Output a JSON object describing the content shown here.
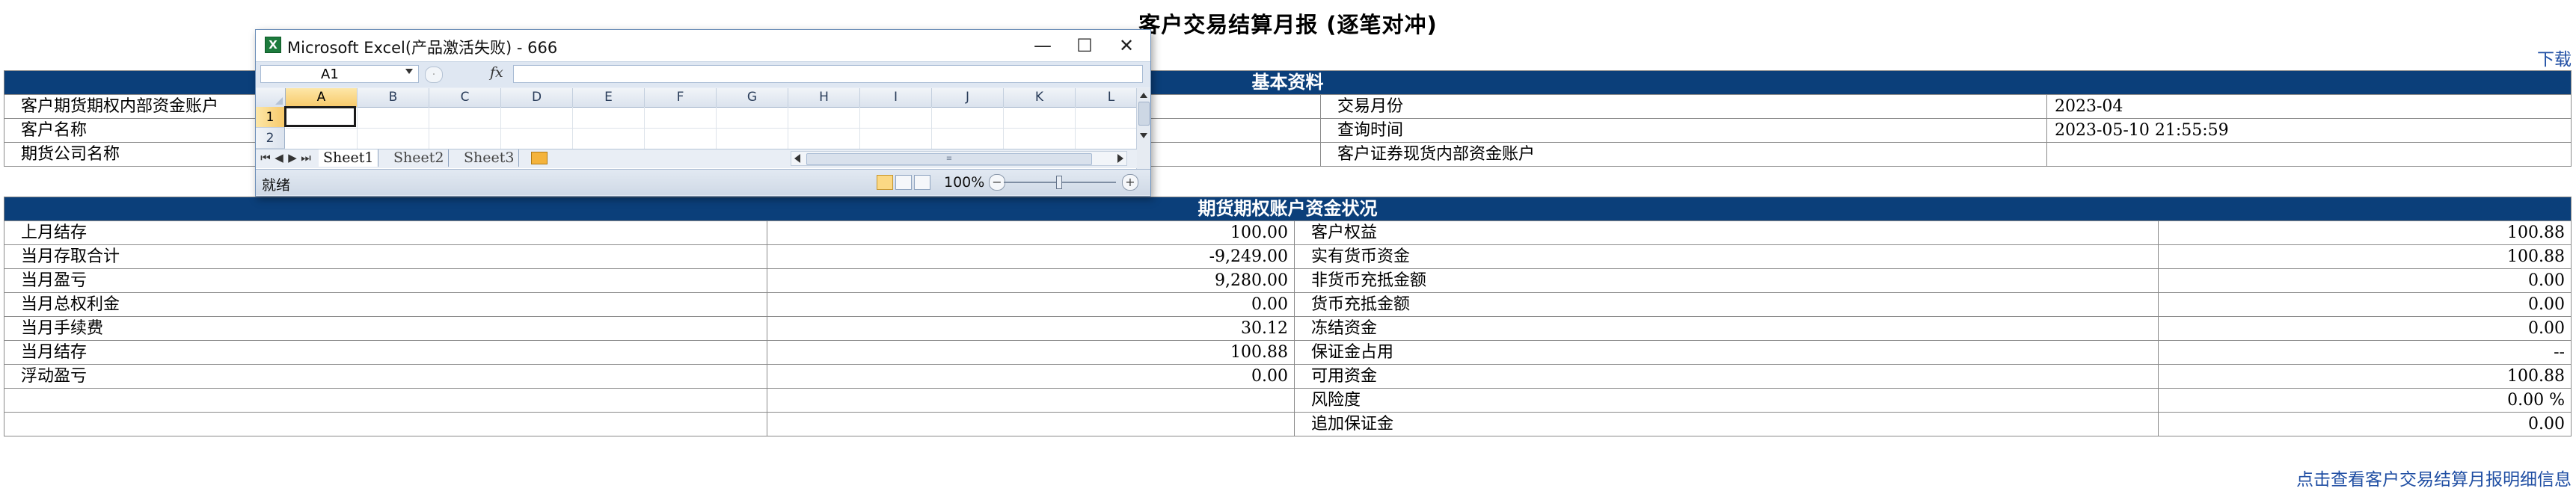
{
  "page": {
    "title": "客户交易结算月报 (逐笔对冲)",
    "download_label": "下载",
    "detail_link": "点击查看客户交易结算月报明细信息"
  },
  "basic_info": {
    "header": "基本资料",
    "rows": [
      {
        "label1": "客户期货期权内部资金账户",
        "value1": "",
        "label2": "交易月份",
        "value2": "2023-04"
      },
      {
        "label1": "客户名称",
        "value1": "",
        "label2": "查询时间",
        "value2": "2023-05-10 21:55:59"
      },
      {
        "label1": "期货公司名称",
        "value1": "",
        "label2": "客户证券现货内部资金账户",
        "value2": ""
      }
    ]
  },
  "funds": {
    "header": "期货期权账户资金状况",
    "rows": [
      {
        "label1": "上月结存",
        "value1": "100.00",
        "label2": "客户权益",
        "value2": "100.88"
      },
      {
        "label1": "当月存取合计",
        "value1": "-9,249.00",
        "label2": "实有货币资金",
        "value2": "100.88"
      },
      {
        "label1": "当月盈亏",
        "value1": "9,280.00",
        "label2": "非货币充抵金额",
        "value2": "0.00"
      },
      {
        "label1": "当月总权利金",
        "value1": "0.00",
        "label2": "货币充抵金额",
        "value2": "0.00"
      },
      {
        "label1": "当月手续费",
        "value1": "30.12",
        "label2": "冻结资金",
        "value2": "0.00"
      },
      {
        "label1": "当月结存",
        "value1": "100.88",
        "label2": "保证金占用",
        "value2": "--"
      },
      {
        "label1": "浮动盈亏",
        "value1": "0.00",
        "label2": "可用资金",
        "value2": "100.88"
      },
      {
        "label1": "",
        "value1": "",
        "label2": "风险度",
        "value2": "0.00 %"
      },
      {
        "label1": "",
        "value1": "",
        "label2": "追加保证金",
        "value2": "0.00"
      }
    ]
  },
  "excel": {
    "title": "Microsoft Excel(产品激活失败) - 666",
    "app_icon_glyph": "X",
    "minimize_glyph": "—",
    "maximize_glyph": "☐",
    "close_glyph": "✕",
    "name_box": "A1",
    "fx_label": "fx",
    "columns": [
      "A",
      "B",
      "C",
      "D",
      "E",
      "F",
      "G",
      "H",
      "I",
      "J",
      "K",
      "L"
    ],
    "rows": [
      "1",
      "2"
    ],
    "selected_column": "A",
    "selected_row": "1",
    "sheets": [
      "Sheet1",
      "Sheet2",
      "Sheet3"
    ],
    "active_sheet": "Sheet1",
    "status": "就绪",
    "zoom": "100%",
    "zoom_minus": "−",
    "zoom_plus": "+",
    "nav_glyphs": [
      "⏮",
      "◀",
      "▶",
      "⏭"
    ]
  }
}
